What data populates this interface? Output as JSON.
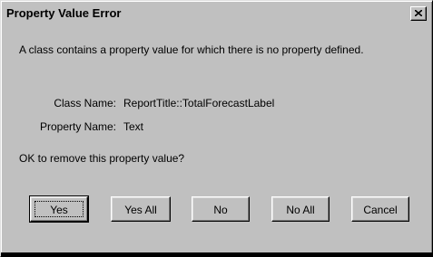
{
  "dialog": {
    "title": "Property Value Error",
    "close_symbol": "×",
    "message": "A class contains a property value for which there is no property defined.",
    "class_name_label": "Class Name:",
    "class_name_value": "ReportTitle::TotalForecastLabel",
    "property_name_label": "Property Name:",
    "property_name_value": "Text",
    "question": "OK to remove this property value?"
  },
  "buttons": {
    "yes": "Yes",
    "yes_all": "Yes All",
    "no": "No",
    "no_all": "No All",
    "cancel": "Cancel"
  },
  "icons": {
    "close": "close-icon"
  },
  "colors": {
    "face": "#c0c0c0",
    "highlight": "#ffffff",
    "shadow": "#808080",
    "dark_shadow": "#000000"
  }
}
